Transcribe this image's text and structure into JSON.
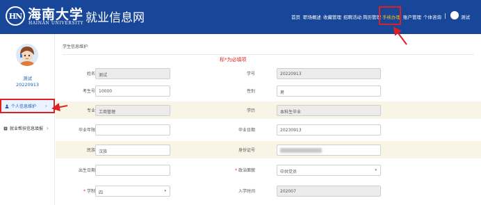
{
  "header": {
    "logo_mark": "HN",
    "logo_cn": "海南大学",
    "logo_en": "HAINAN UNIVERSITY",
    "site_title": "就业信息网",
    "nav": [
      "首页",
      "职场概述",
      "收藏管理",
      "招聘活动",
      "简历管理",
      "手续办理",
      "账户管理",
      "个体咨询"
    ],
    "active_nav": "手续办理",
    "separator": "|",
    "user": "测试"
  },
  "sidebar": {
    "name": "测试",
    "student_id": "20220913",
    "items": [
      {
        "label": "个人信息维护",
        "active": true
      },
      {
        "label": "就业帮扶信息填报",
        "active": false
      }
    ]
  },
  "main": {
    "breadcrumb": "学生信息维护",
    "required_note": "标*为必填项",
    "fields": [
      {
        "left": {
          "label": "姓名",
          "value": "测试",
          "readonly": true
        },
        "right": {
          "label": "学号",
          "value": "20220913",
          "readonly": true
        }
      },
      {
        "left": {
          "label": "考生号",
          "value": "10000",
          "readonly": false
        },
        "right": {
          "label": "性别",
          "value": "男",
          "readonly": false
        }
      },
      {
        "left": {
          "label": "专业",
          "value": "工商管理",
          "readonly": true
        },
        "right": {
          "label": "学历",
          "value": "本科生毕业",
          "readonly": true
        }
      },
      {
        "left": {
          "label": "毕业年限",
          "value": "",
          "readonly": false
        },
        "right": {
          "label": "毕业日期",
          "value": "20230913",
          "readonly": false
        }
      },
      {
        "left": {
          "label": "民族",
          "value": "汉族",
          "readonly": false
        },
        "right": {
          "label": "身份证号",
          "value": "",
          "readonly": false
        }
      },
      {
        "left": {
          "label": "出生日期",
          "value": "",
          "readonly": false
        },
        "right": {
          "label": "政治面貌",
          "value": "中共党员",
          "required": true,
          "select": true
        }
      },
      {
        "left": {
          "label": "学制",
          "value": "四",
          "required": true,
          "select": true
        },
        "right": {
          "label": "入学时间",
          "value": "202007",
          "readonly": true
        }
      }
    ]
  },
  "colors": {
    "header_bg": "#18479a",
    "active_nav": "#f5c518",
    "annotation_red": "#e02020",
    "link_blue": "#1a5fb4"
  }
}
